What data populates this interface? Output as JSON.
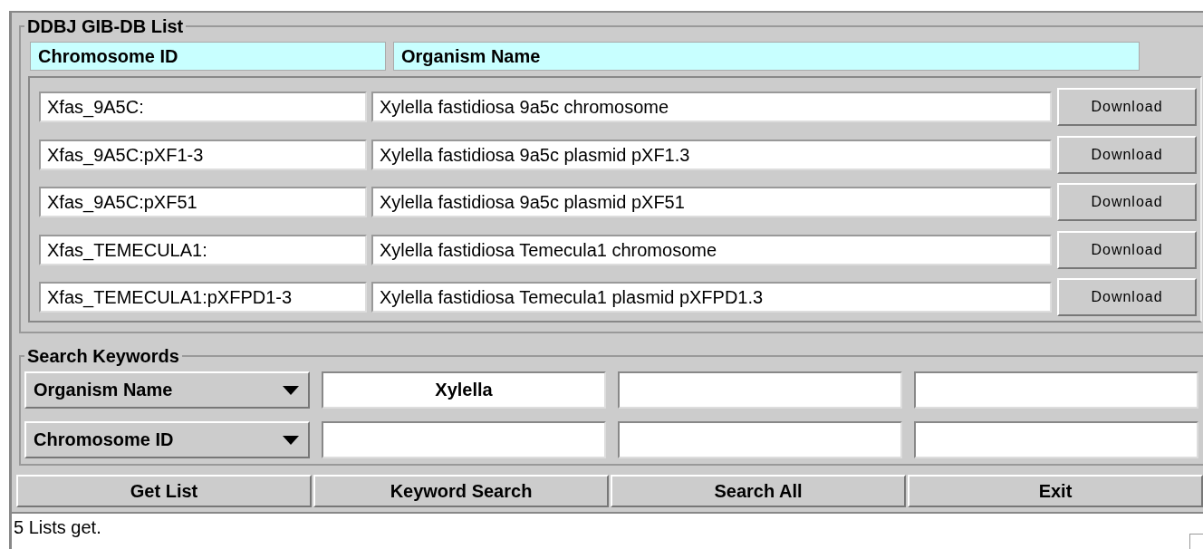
{
  "list_panel": {
    "title": "DDBJ GIB-DB List",
    "columns": [
      "Chromosome ID",
      "Organism Name"
    ],
    "rows": [
      {
        "chromosome_id": "Xfas_9A5C:",
        "organism_name": "Xylella fastidiosa 9a5c chromosome",
        "button": "Download"
      },
      {
        "chromosome_id": "Xfas_9A5C:pXF1-3",
        "organism_name": "Xylella fastidiosa 9a5c plasmid pXF1.3",
        "button": "Download"
      },
      {
        "chromosome_id": "Xfas_9A5C:pXF51",
        "organism_name": "Xylella fastidiosa 9a5c plasmid pXF51",
        "button": "Download"
      },
      {
        "chromosome_id": "Xfas_TEMECULA1:",
        "organism_name": "Xylella fastidiosa Temecula1 chromosome",
        "button": "Download"
      },
      {
        "chromosome_id": "Xfas_TEMECULA1:pXFPD1-3",
        "organism_name": "Xylella fastidiosa Temecula1 plasmid pXFPD1.3",
        "button": "Download"
      }
    ]
  },
  "search_panel": {
    "title": "Search Keywords",
    "criteria": [
      {
        "field": "Organism Name",
        "keyword": "Xylella"
      },
      {
        "field": "Chromosome ID"
      }
    ]
  },
  "buttons": [
    "Get List",
    "Keyword Search",
    "Search All",
    "Exit"
  ],
  "status_bar": "5 Lists get."
}
